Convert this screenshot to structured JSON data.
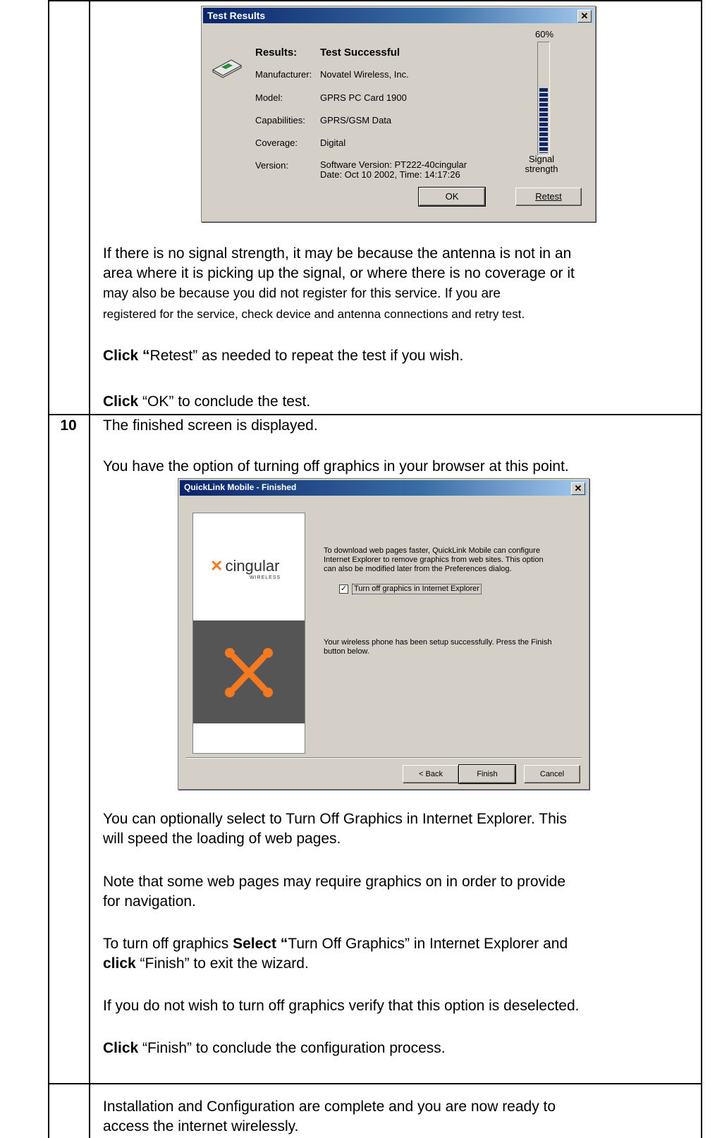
{
  "colors": {
    "accent_orange": "#f47920",
    "titlebar": "#0a246a",
    "dialog_face": "#d4d0c8"
  },
  "test_results": {
    "title": "Test Results",
    "close_glyph": "✕",
    "results_label": "Results:",
    "results_value": "Test Successful",
    "manufacturer_label": "Manufacturer:",
    "manufacturer_value": "Novatel Wireless, Inc.",
    "model_label": "Model:",
    "model_value": "GPRS PC Card 1900",
    "capabilities_label": "Capabilities:",
    "capabilities_value": "GPRS/GSM Data",
    "coverage_label": "Coverage:",
    "coverage_value": "Digital",
    "version_label": "Version:",
    "version_line1": "Software Version: PT222-40cingular",
    "version_line2": "Date: Oct 10 2002, Time: 14:17:26",
    "signal_percent_text": "60%",
    "signal_level": 0.6,
    "signal_label_1": "Signal",
    "signal_label_2": "strength",
    "ok_button": "OK",
    "retest_button": "Retest",
    "icon": "pc-card-icon"
  },
  "step9": {
    "p1_line1": "If there is no signal strength, it may be because the antenna is not in an",
    "p1_line2": "area where it is picking up the signal, or where there is no coverage or it",
    "p1_line3": "may also be because you did not register for this service. If you are",
    "p1_line4": "registered for the service, check device and antenna connections and retry test.",
    "click_retest_bold": "Click “",
    "click_retest_rest": "Retest” as needed to repeat the test if you wish.",
    "click_ok_bold": "Click",
    "click_ok_rest": " “OK” to conclude the test."
  },
  "step10": {
    "number": "10",
    "line1": "The finished screen is displayed.",
    "line2": "You have the option of turning off graphics in your browser at this point.",
    "p_optional_1": "You can optionally select to Turn Off Graphics in Internet Explorer.  This",
    "p_optional_2": "will speed the loading of web pages.",
    "p_note_1": "Note that some web pages may require graphics on in order to provide",
    "p_note_2": "for navigation.",
    "p_turnoff_a": "To turn off graphics ",
    "p_turnoff_b": "Select “",
    "p_turnoff_c": "Turn Off Graphics” in Internet Explorer and",
    "p_turnoff_d": "click",
    "p_turnoff_e": " “Finish” to exit the wizard.",
    "p_verify": "If you do not wish to turn off graphics verify that this option is deselected.",
    "p_finish_bold": "Click",
    "p_finish_rest": " “Finish” to conclude the configuration process."
  },
  "quicklink": {
    "title": "QuickLink Mobile - Finished",
    "close_glyph": "✕",
    "logo_text": "cingular",
    "logo_sub": "WIRELESS",
    "logo_icon": "cingular-x-icon",
    "desc_1": "To download web pages faster, QuickLink Mobile can configure",
    "desc_2": "Internet Explorer to remove graphics from web sites. This option",
    "desc_3": "can also be modified later from the Preferences dialog.",
    "checkbox_label": "Turn off graphics in Internet Explorer",
    "checkbox_checked": true,
    "success_1": "Your wireless phone has been setup successfully.  Press the Finish",
    "success_2": "button below.",
    "back_button": "< Back",
    "finish_button": "Finish",
    "cancel_button": "Cancel"
  },
  "final_step": {
    "line1": "Installation and Configuration are complete and you are now ready to",
    "line2": "access the internet wirelessly."
  }
}
